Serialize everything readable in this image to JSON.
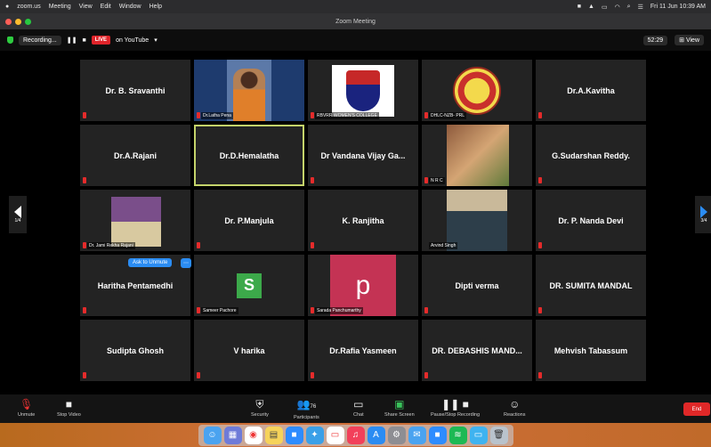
{
  "macbar": {
    "apple": "",
    "menus": [
      "zoom.us",
      "Meeting",
      "View",
      "Edit",
      "Window",
      "Help"
    ],
    "clock": "Fri 11 Jun 10:39 AM"
  },
  "window": {
    "title": "Zoom Meeting"
  },
  "topstrip": {
    "recording": "Recording...",
    "live": "LIVE",
    "platform": "on YouTube",
    "timer": "52:29",
    "view": "View"
  },
  "participants": [
    {
      "name": "Dr. B. Sravanthi"
    },
    {
      "caption": "Dr.Latha Pena"
    },
    {
      "caption": "RBVRR WOMEN'S COLLEGE"
    },
    {
      "caption": "DHLC-NZB- PRL"
    },
    {
      "name": "Dr.A.Kavitha"
    },
    {
      "name": "Dr.A.Rajani"
    },
    {
      "name": "Dr.D.Hemalatha"
    },
    {
      "name": "Dr Vandana Vijay Ga..."
    },
    {
      "caption": "N R C"
    },
    {
      "name": "G.Sudarshan Reddy."
    },
    {
      "caption": "Dr. Jami Rekha Rajani"
    },
    {
      "name": "Dr. P.Manjula"
    },
    {
      "name": "K. Ranjitha"
    },
    {
      "caption": "Arvind Singh"
    },
    {
      "name": "Dr. P. Nanda Devi"
    },
    {
      "name": "Haritha Pentamedhi"
    },
    {
      "caption": "Sameer Pachore",
      "letter": "S"
    },
    {
      "caption": "Sarada Panchumarthy",
      "letter": "p"
    },
    {
      "name": "Dipti verma"
    },
    {
      "name": "DR. SUMITA MANDAL"
    },
    {
      "name": "Sudipta Ghosh"
    },
    {
      "name": "V harika"
    },
    {
      "name": "Dr.Rafia Yasmeen"
    },
    {
      "name": "DR. DEBASHIS MAND..."
    },
    {
      "name": "Mehvish Tabassum"
    }
  ],
  "ask_unmute": "Ask to Unmute",
  "page_arrows": {
    "left": "1/4",
    "right": "3/4"
  },
  "toolbar": {
    "unmute": "Unmute",
    "stop_video": "Stop Video",
    "security": "Security",
    "participants": "Participants",
    "participants_count": "76",
    "chat": "Chat",
    "share_screen": "Share Screen",
    "pause_recording": "Pause/Stop Recording",
    "reactions": "Reactions",
    "end": "End"
  },
  "dock_icons": [
    "finder-icon",
    "launchpad-icon",
    "chrome-icon",
    "notes-icon",
    "zoom-icon",
    "safari-icon",
    "calendar-icon",
    "music-icon",
    "appstore-icon",
    "settings-icon",
    "mail-icon",
    "zoom-icon",
    "spotify-icon",
    "photos-icon",
    "trash-icon"
  ]
}
